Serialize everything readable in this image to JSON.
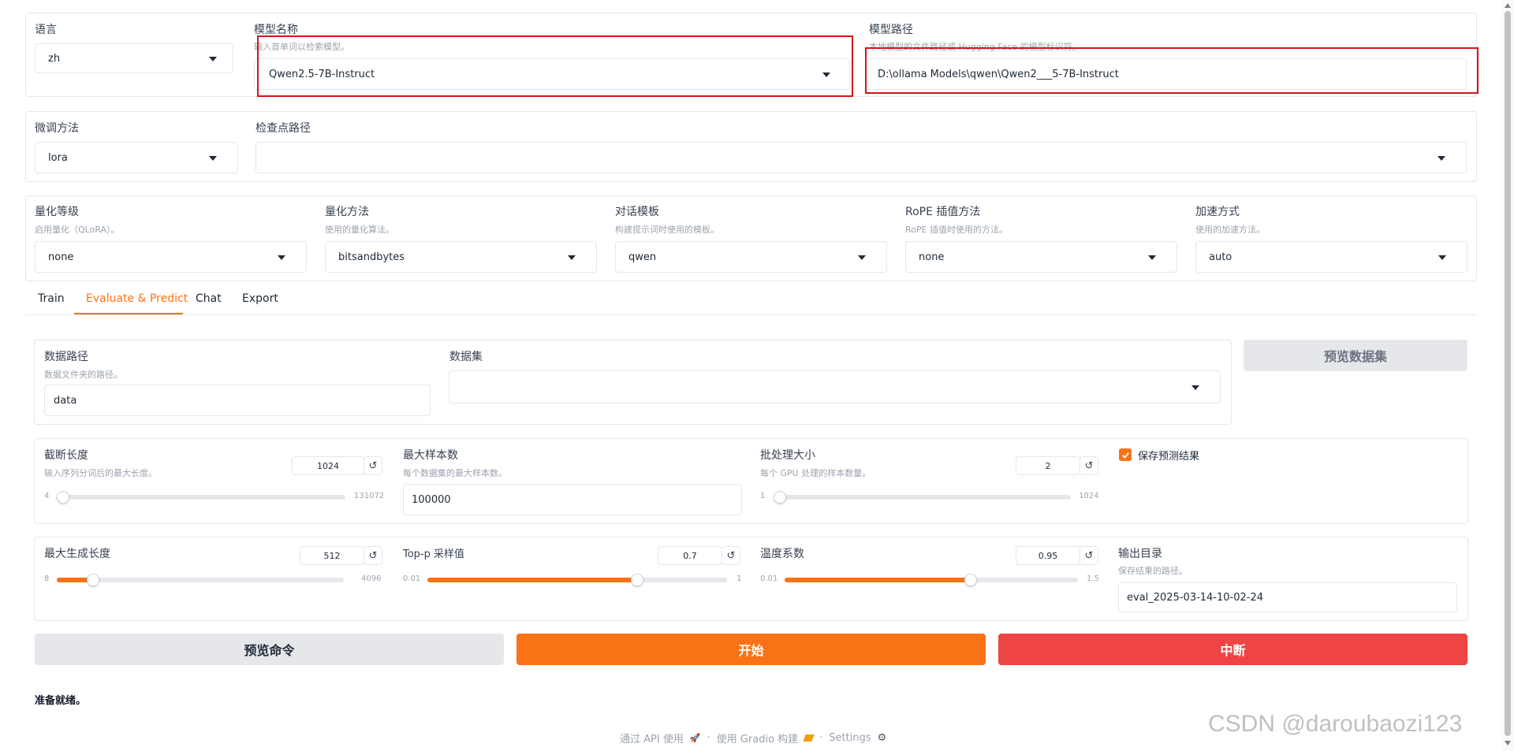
{
  "model_row": {
    "lang": {
      "label": "语言",
      "value": "zh"
    },
    "model_name": {
      "label": "模型名称",
      "info": "输入首单词以检索模型。",
      "value": "Qwen2.5-7B-Instruct"
    },
    "model_path": {
      "label": "模型路径",
      "info": "本地模型的文件路径或 Hugging Face 的模型标识符。",
      "value": "D:\\ollama Models\\qwen\\Qwen2___5-7B-Instruct"
    }
  },
  "finetune_row": {
    "method": {
      "label": "微调方法",
      "value": "lora"
    },
    "checkpoint": {
      "label": "检查点路径",
      "value": ""
    }
  },
  "advanced_row": {
    "quant_bit": {
      "label": "量化等级",
      "info": "启用量化（QLoRA）。",
      "value": "none"
    },
    "quant_method": {
      "label": "量化方法",
      "info": "使用的量化算法。",
      "value": "bitsandbytes"
    },
    "template": {
      "label": "对话模板",
      "info": "构建提示词时使用的模板。",
      "value": "qwen"
    },
    "rope": {
      "label": "RoPE 插值方法",
      "info": "RoPE 插值时使用的方法。",
      "value": "none"
    },
    "booster": {
      "label": "加速方式",
      "info": "使用的加速方法。",
      "value": "auto"
    }
  },
  "tabs": [
    {
      "label": "Train"
    },
    {
      "label": "Evaluate & Predict"
    },
    {
      "label": "Chat"
    },
    {
      "label": "Export"
    }
  ],
  "active_tab": "Evaluate & Predict",
  "eval": {
    "dataset_dir": {
      "label": "数据路径",
      "info": "数据文件夹的路径。",
      "value": "data"
    },
    "dataset": {
      "label": "数据集",
      "value": ""
    },
    "preview_btn": "预览数据集",
    "cutoff_len": {
      "label": "截断长度",
      "info": "输入序列分词后的最大长度。",
      "value": "1024",
      "min": "4",
      "max": "131072",
      "fraction": 0.008
    },
    "max_samples": {
      "label": "最大样本数",
      "info": "每个数据集的最大样本数。",
      "value": "100000"
    },
    "batch_size": {
      "label": "批处理大小",
      "info": "每个 GPU 处理的样本数量。",
      "value": "2",
      "min": "1",
      "max": "1024",
      "fraction": 0.001
    },
    "predict": {
      "label": "保存预测结果",
      "checked": true
    },
    "max_new_tokens": {
      "label": "最大生成长度",
      "value": "512",
      "min": "8",
      "max": "4096",
      "fraction": 0.123
    },
    "top_p": {
      "label": "Top-p 采样值",
      "value": "0.7",
      "min": "0.01",
      "max": "1",
      "fraction": 0.697
    },
    "temperature": {
      "label": "温度系数",
      "value": "0.95",
      "min": "0.01",
      "max": "1.5",
      "fraction": 0.631
    },
    "output_dir": {
      "label": "输出目录",
      "info": "保存结果的路径。",
      "value": "eval_2025-03-14-10-02-24"
    },
    "reset_glyph": "↺",
    "cmd_btn": "预览命令",
    "start_btn": "开始",
    "stop_btn": "中断",
    "status": "准备就绪。"
  },
  "footer": {
    "api": "通过 API 使用",
    "sep1": "·",
    "gradio": "使用 Gradio 构建",
    "sep2": "·",
    "settings": "Settings"
  },
  "watermark": "CSDN @daroubaozi123",
  "colors": {
    "accent": "#f97316",
    "stop": "#ef4444",
    "highlight": "#d4161c"
  }
}
